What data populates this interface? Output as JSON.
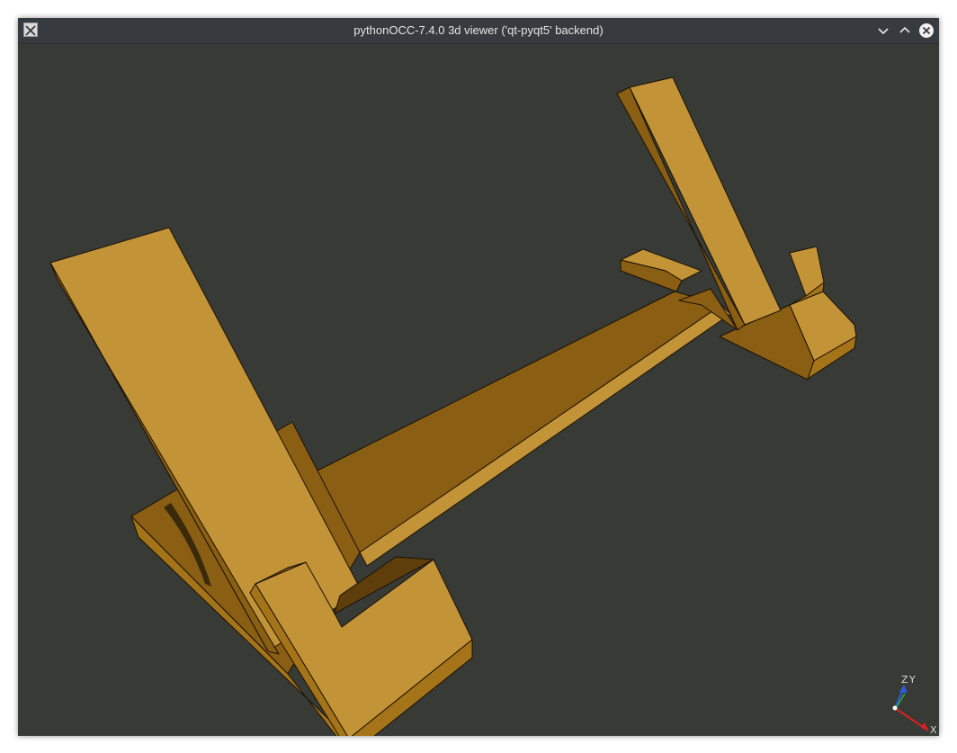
{
  "window": {
    "title": "pythonOCC-7.4.0 3d viewer ('qt-pyqt5' backend)",
    "icon": "x11-app-icon",
    "buttons": [
      "minimize-chevron-icon",
      "maximize-chevron-icon",
      "close-circle-icon"
    ]
  },
  "viewer": {
    "background_color": "#383a35",
    "model_color": "#c29337",
    "model_shade_dark": "#8a5e13",
    "model_shade_mid": "#a57419",
    "model_name": ""
  },
  "trihedron": {
    "z_label": "Z",
    "y_label": "Y",
    "x_label": "X",
    "z_color": "#2e5be0",
    "y_color": "#27b33c",
    "x_color": "#e02020"
  }
}
